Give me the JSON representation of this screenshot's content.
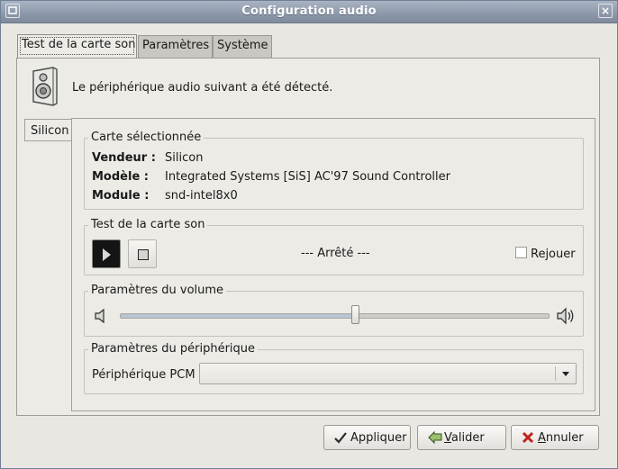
{
  "window": {
    "title": "Configuration audio",
    "menu_icon": "window-menu-icon",
    "close_icon": "close-icon",
    "close_glyph": "×"
  },
  "tabs": [
    {
      "label": "Test de la carte son",
      "active": true
    },
    {
      "label": "Paramètres",
      "active": false
    },
    {
      "label": "Système",
      "active": false
    }
  ],
  "header": {
    "icon": "speaker-device-icon",
    "message": "Le périphérique audio suivant a été détecté."
  },
  "card_tab": {
    "label": "Silicon"
  },
  "selected_card": {
    "legend": "Carte sélectionnée",
    "rows": [
      {
        "key": "Vendeur :",
        "value": "Silicon"
      },
      {
        "key": "Modèle :",
        "value": "Integrated Systems [SiS] AC'97 Sound Controller"
      },
      {
        "key": "Module :",
        "value": "snd-intel8x0"
      }
    ]
  },
  "test": {
    "legend": "Test de la carte son",
    "play_icon": "play-icon",
    "stop_icon": "stop-icon",
    "status": "--- Arrêté ---",
    "replay_label": "Rejouer",
    "replay_checked": false
  },
  "volume": {
    "legend": "Paramètres du volume",
    "low_icon": "volume-low-icon",
    "high_icon": "volume-high-icon",
    "level": 0.55
  },
  "device": {
    "legend": "Paramètres du périphérique",
    "pcm_label": "Périphérique PCM",
    "pcm_value": ""
  },
  "buttons": {
    "apply": {
      "label": "Appliquer",
      "icon": "check-icon"
    },
    "ok": {
      "label": "Valider",
      "icon": "arrow-apply-icon"
    },
    "cancel": {
      "label": "Annuler",
      "icon": "cancel-x-icon"
    }
  },
  "colors": {
    "cancel_red": "#c0221b",
    "check_dark": "#2a2a2a",
    "ok_green": "#4f7a2e"
  }
}
